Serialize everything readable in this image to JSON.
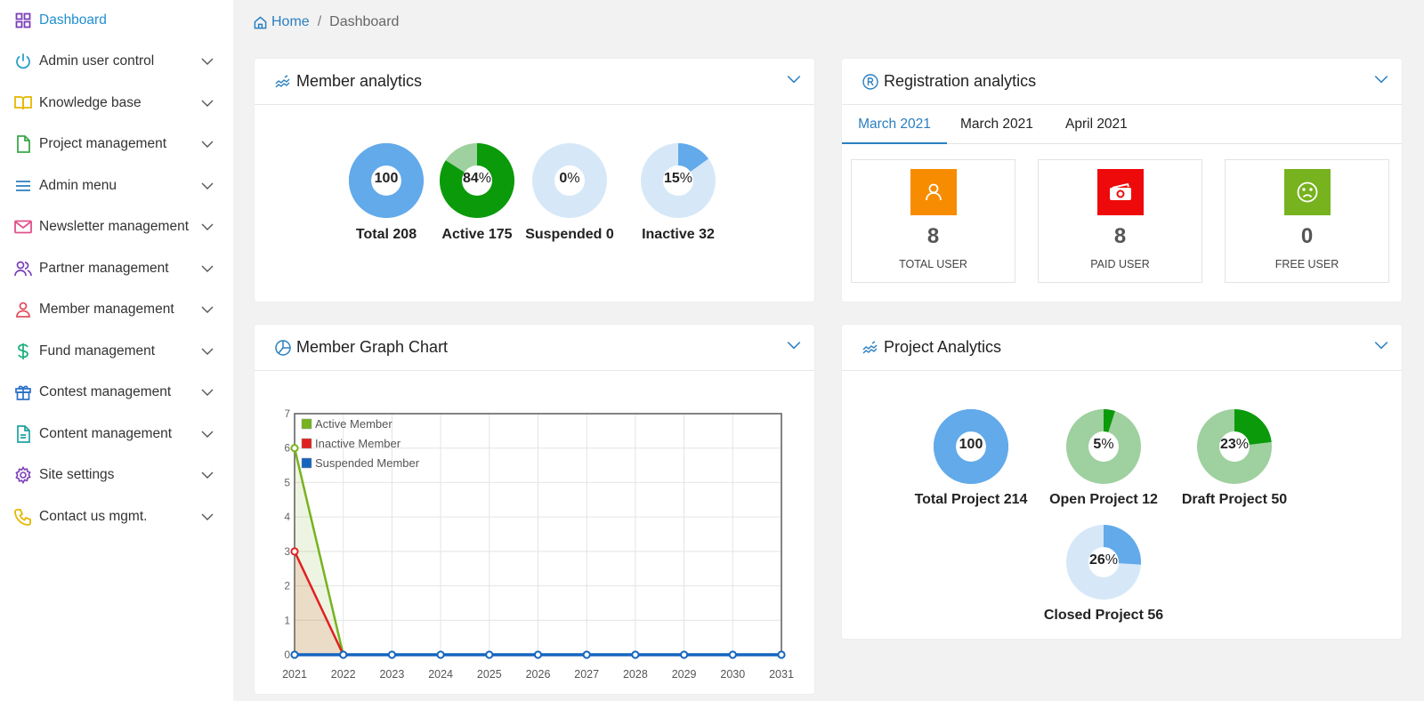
{
  "sidebar": {
    "items": [
      {
        "label": "Dashboard",
        "icon": "grid-icon",
        "active": true
      },
      {
        "label": "Admin user control",
        "icon": "power-icon"
      },
      {
        "label": "Knowledge base",
        "icon": "book-icon"
      },
      {
        "label": "Project management",
        "icon": "file-icon"
      },
      {
        "label": "Admin menu",
        "icon": "menu-icon"
      },
      {
        "label": "Newsletter management",
        "icon": "mail-icon"
      },
      {
        "label": "Partner management",
        "icon": "users-icon"
      },
      {
        "label": "Member management",
        "icon": "user-icon"
      },
      {
        "label": "Fund management",
        "icon": "dollar-icon"
      },
      {
        "label": "Contest management",
        "icon": "gift-icon"
      },
      {
        "label": "Content management",
        "icon": "document-icon"
      },
      {
        "label": "Site settings",
        "icon": "gear-icon"
      },
      {
        "label": "Contact us mgmt.",
        "icon": "phone-icon"
      }
    ]
  },
  "breadcrumb": {
    "home": "Home",
    "separator": "/",
    "current": "Dashboard"
  },
  "member_analytics": {
    "title": "Member analytics",
    "items": [
      {
        "value": "100",
        "suffix": "",
        "label": "Total 208",
        "fraction": 1.0,
        "color": "#62aaea",
        "track": "#62aaea"
      },
      {
        "value": "84",
        "suffix": "%",
        "label": "Active 175",
        "fraction": 0.84,
        "color": "#0a9a0a",
        "track": "#9fd09f"
      },
      {
        "value": "0",
        "suffix": "%",
        "label": "Suspended 0",
        "fraction": 0.0,
        "color": "#62aaea",
        "track": "#d6e8f8"
      },
      {
        "value": "15",
        "suffix": "%",
        "label": "Inactive 32",
        "fraction": 0.15,
        "color": "#62aaea",
        "track": "#d6e8f8"
      }
    ]
  },
  "registration_analytics": {
    "title": "Registration analytics",
    "tabs": [
      {
        "label": "March 2021",
        "active": true
      },
      {
        "label": "March 2021",
        "active": false
      },
      {
        "label": "April 2021",
        "active": false
      }
    ],
    "stats": [
      {
        "value": "8",
        "label": "TOTAL USER",
        "icon": "user-icon",
        "color": "#f78c00"
      },
      {
        "value": "8",
        "label": "PAID USER",
        "icon": "money-icon",
        "color": "#ee0a0a"
      },
      {
        "value": "0",
        "label": "FREE USER",
        "icon": "sad-face-icon",
        "color": "#77b21f"
      }
    ]
  },
  "member_graph": {
    "title": "Member Graph Chart"
  },
  "project_analytics": {
    "title": "Project Analytics",
    "items": [
      {
        "value": "100",
        "suffix": "",
        "label": "Total Project 214",
        "fraction": 1.0,
        "color": "#62aaea",
        "track": "#62aaea"
      },
      {
        "value": "5",
        "suffix": "%",
        "label": "Open Project 12",
        "fraction": 0.05,
        "color": "#0a9a0a",
        "track": "#9fd09f"
      },
      {
        "value": "23",
        "suffix": "%",
        "label": "Draft Project 50",
        "fraction": 0.23,
        "color": "#0a9a0a",
        "track": "#9fd09f"
      },
      {
        "value": "26",
        "suffix": "%",
        "label": "Closed Project 56",
        "fraction": 0.26,
        "color": "#62aaea",
        "track": "#d6e8f8"
      }
    ]
  },
  "chart_data": {
    "type": "line",
    "title": "Member Graph Chart",
    "xlabel": "",
    "ylabel": "",
    "x": [
      "2021",
      "2022",
      "2023",
      "2024",
      "2025",
      "2026",
      "2027",
      "2028",
      "2029",
      "2030",
      "2031"
    ],
    "ylim": [
      0,
      7
    ],
    "yticks": [
      0,
      1,
      2,
      3,
      4,
      5,
      6,
      7
    ],
    "grid": true,
    "legend": "top-left",
    "series": [
      {
        "name": "Active Member",
        "color": "#77b21f",
        "values": [
          6,
          0,
          0,
          0,
          0,
          0,
          0,
          0,
          0,
          0,
          0
        ]
      },
      {
        "name": "Inactive Member",
        "color": "#e02020",
        "values": [
          3,
          0,
          0,
          0,
          0,
          0,
          0,
          0,
          0,
          0,
          0
        ]
      },
      {
        "name": "Suspended Member",
        "color": "#1565c0",
        "values": [
          0,
          0,
          0,
          0,
          0,
          0,
          0,
          0,
          0,
          0,
          0
        ]
      }
    ]
  }
}
